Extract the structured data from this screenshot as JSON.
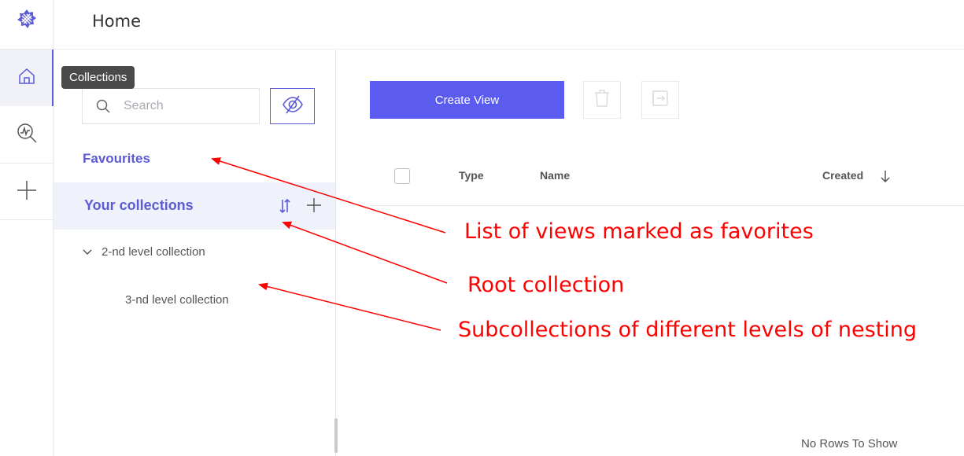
{
  "header": {
    "title": "Home"
  },
  "rail": {
    "items": [
      {
        "icon": "logo-icon"
      },
      {
        "icon": "home-icon",
        "active": true
      },
      {
        "icon": "analytics-search-icon"
      },
      {
        "icon": "plus-icon"
      }
    ]
  },
  "collections_panel": {
    "tooltip": "Collections",
    "search_placeholder": "Search",
    "favourites_label": "Favourites",
    "your_collections_label": "Your collections",
    "tree": [
      {
        "label": "2-nd level collection",
        "expanded": true
      },
      {
        "label": "3-nd level collection"
      }
    ]
  },
  "toolbar": {
    "create_view_label": "Create View"
  },
  "table": {
    "columns": [
      "Type",
      "Name",
      "Created"
    ],
    "empty_text": "No Rows To Show"
  },
  "annotations": {
    "favourites": "List of views marked as favorites",
    "root": "Root collection",
    "subcollections": "Subcollections of different levels of nesting"
  },
  "colors": {
    "accent": "#5b5bd6",
    "button": "#5b5bf0",
    "annotation": "#ff0000"
  }
}
